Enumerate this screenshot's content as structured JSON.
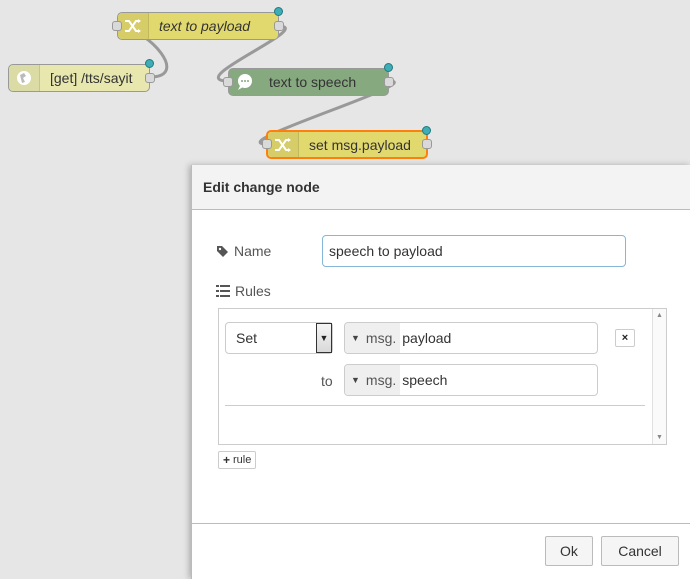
{
  "flow": {
    "nodes": [
      {
        "id": "n1",
        "label": "text to payload",
        "type": "change",
        "icon": "shuffle-icon",
        "italic": true
      },
      {
        "id": "n2",
        "label": "[get] /tts/sayit",
        "type": "http-in",
        "icon": "globe-icon",
        "italic": false
      },
      {
        "id": "n3",
        "label": "text to speech",
        "type": "tts",
        "icon": "speech-bubble-icon",
        "italic": false
      },
      {
        "id": "n4",
        "label": "set msg.payload",
        "type": "change",
        "icon": "shuffle-icon",
        "italic": false,
        "selected": true
      }
    ],
    "colors": {
      "change": "#e2d96e",
      "http": "#e7e7ae",
      "tts": "#87a980",
      "selected_outline": "#ff7f0e",
      "status": "#3fadb5"
    }
  },
  "tray": {
    "title": "Edit change node",
    "name_label": "Name",
    "name_value": "speech to payload",
    "rules_label": "Rules",
    "rule": {
      "action": "Set",
      "property_type": "msg.",
      "property_value": "payload",
      "to_label": "to",
      "to_type": "msg.",
      "to_value": "speech",
      "delete_label": "×"
    },
    "add_rule_label": "rule",
    "ok_label": "Ok",
    "cancel_label": "Cancel"
  }
}
